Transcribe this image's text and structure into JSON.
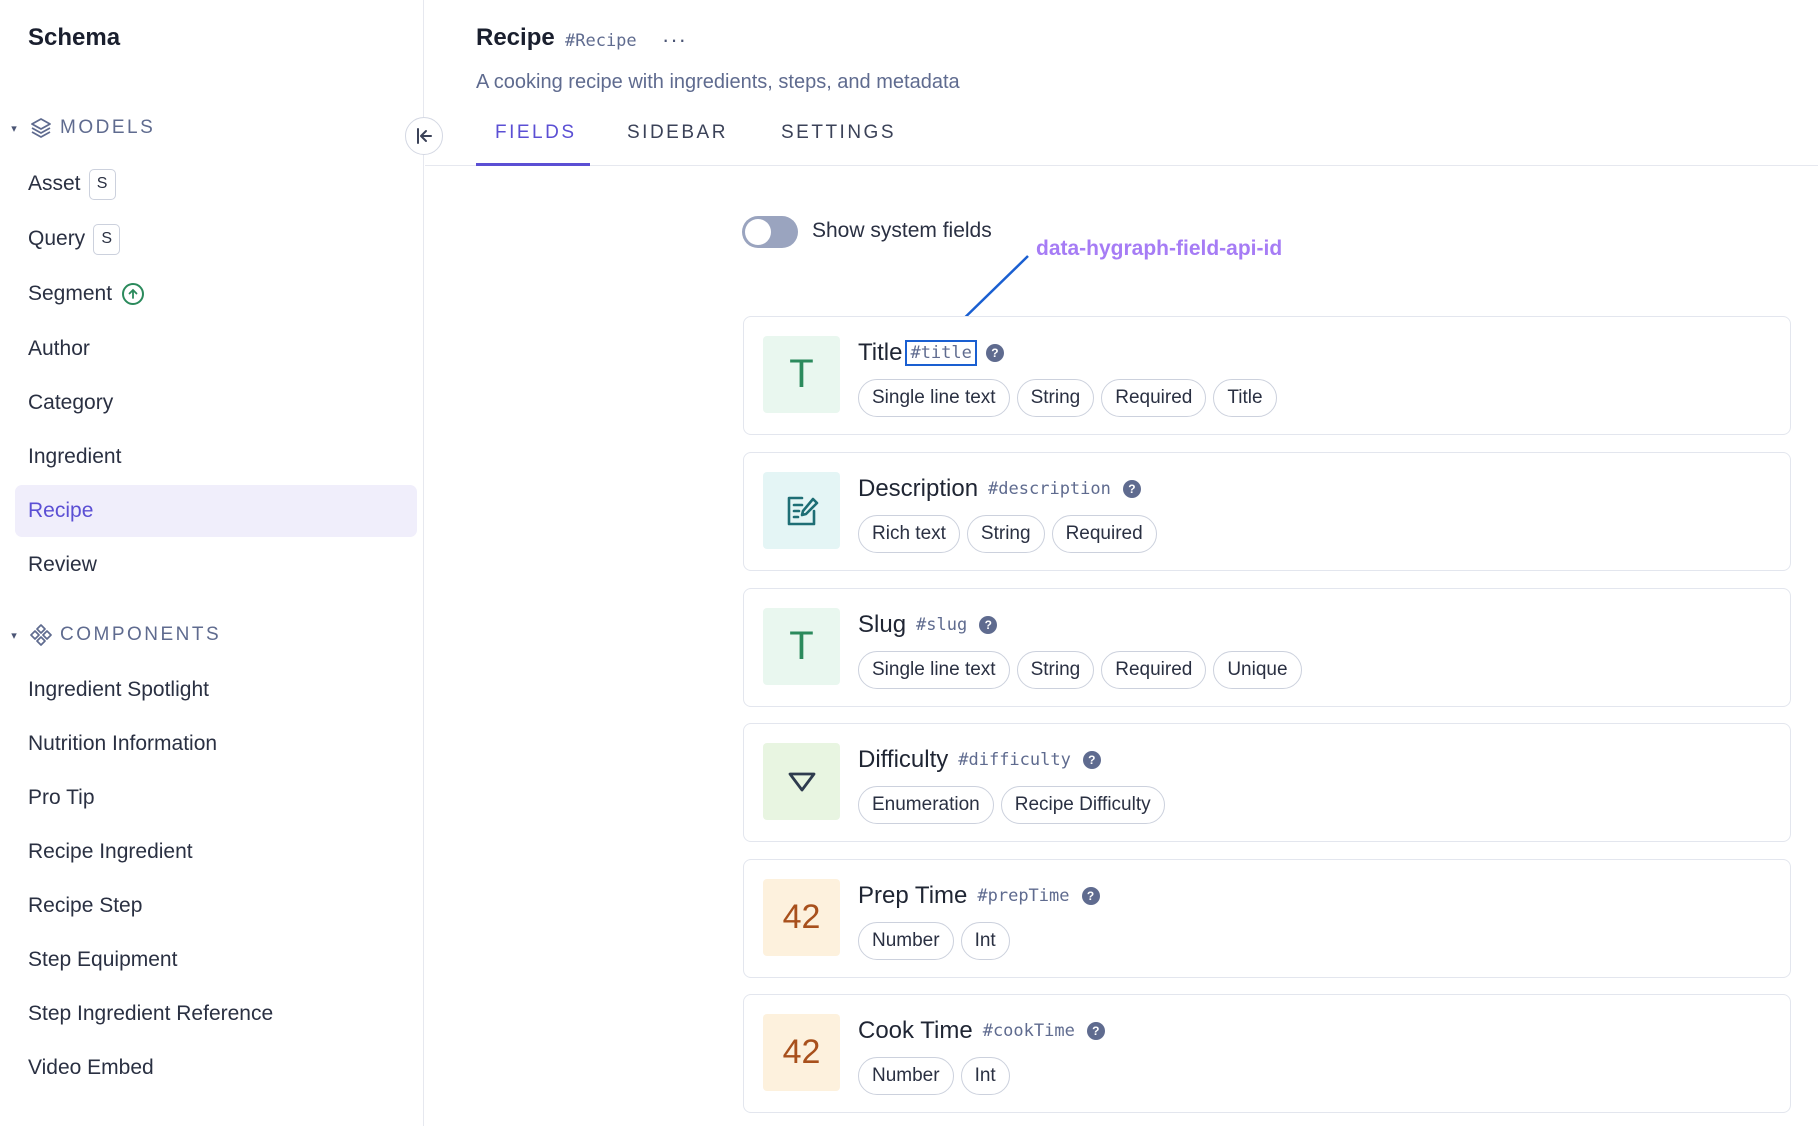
{
  "sidebar": {
    "title": "Schema",
    "models_label": "MODELS",
    "components_label": "COMPONENTS",
    "models": [
      {
        "label": "Asset",
        "badge": "S"
      },
      {
        "label": "Query",
        "badge": "S"
      },
      {
        "label": "Segment"
      },
      {
        "label": "Author"
      },
      {
        "label": "Category"
      },
      {
        "label": "Ingredient"
      },
      {
        "label": "Recipe"
      },
      {
        "label": "Review"
      }
    ],
    "components": [
      {
        "label": "Ingredient Spotlight"
      },
      {
        "label": "Nutrition Information"
      },
      {
        "label": "Pro Tip"
      },
      {
        "label": "Recipe Ingredient"
      },
      {
        "label": "Recipe Step"
      },
      {
        "label": "Step Equipment"
      },
      {
        "label": "Step Ingredient Reference"
      },
      {
        "label": "Video Embed"
      }
    ]
  },
  "header": {
    "title": "Recipe",
    "api_id": "#Recipe",
    "more": "···",
    "description": "A cooking recipe with ingredients, steps, and metadata",
    "tabs": [
      {
        "label": "FIELDS"
      },
      {
        "label": "SIDEBAR"
      },
      {
        "label": "SETTINGS"
      }
    ]
  },
  "toggle": {
    "label": "Show system fields",
    "checked": false
  },
  "annotation": {
    "text": "data-hygraph-field-api-id"
  },
  "fields": [
    {
      "name": "Title",
      "api_id": "#title",
      "icon": "T",
      "chips": [
        "Single line text",
        "String",
        "Required",
        "Title"
      ]
    },
    {
      "name": "Description",
      "api_id": "#description",
      "icon": "rich-text-icon",
      "chips": [
        "Rich text",
        "String",
        "Required"
      ]
    },
    {
      "name": "Slug",
      "api_id": "#slug",
      "icon": "T",
      "chips": [
        "Single line text",
        "String",
        "Required",
        "Unique"
      ]
    },
    {
      "name": "Difficulty",
      "api_id": "#difficulty",
      "icon": "enumeration-icon",
      "chips": [
        "Enumeration",
        "Recipe Difficulty"
      ]
    },
    {
      "name": "Prep Time",
      "api_id": "#prepTime",
      "icon": "42",
      "chips": [
        "Number",
        "Int"
      ]
    },
    {
      "name": "Cook Time",
      "api_id": "#cookTime",
      "icon": "42",
      "chips": [
        "Number",
        "Int"
      ]
    }
  ],
  "colors": {
    "accent": "#5b4fd4",
    "annotation": "#a67cf5",
    "annotation_box": "#1a5fd1",
    "text_icon_bg": "#e9f7ef",
    "text_icon_fg": "#2b8a5c",
    "rich_icon_bg": "#e4f5f5",
    "rich_icon_fg": "#1e6e75",
    "enum_icon_bg": "#e8f5e1",
    "enum_icon_fg": "#2e3b4e",
    "number_icon_bg": "#fdf1dd",
    "number_icon_fg": "#a8501c"
  }
}
